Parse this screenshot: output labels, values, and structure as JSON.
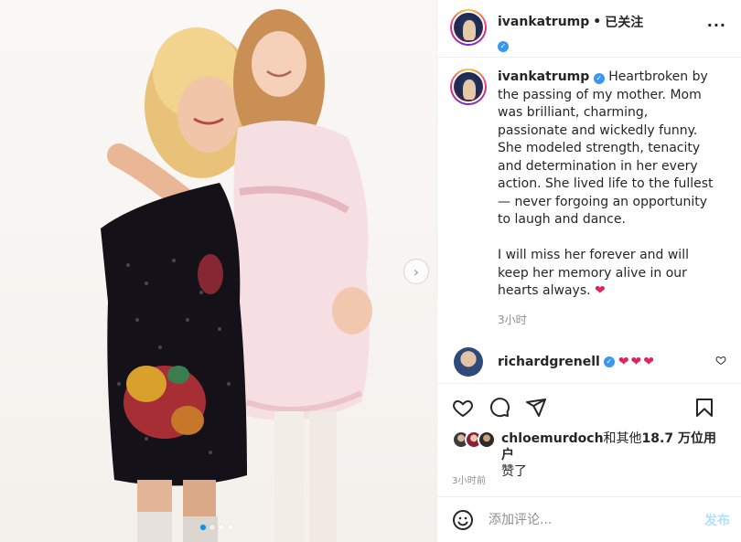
{
  "header": {
    "username": "ivankatrump",
    "separator": "•",
    "follow_status": "已关注",
    "more_label": "···"
  },
  "caption": {
    "username": "ivankatrump",
    "text": "Heartbroken by the passing of my mother. Mom was brilliant, charming, passionate and wickedly funny. She modeled strength, tenacity and determination in her every action. She lived life to the fullest — never forgoing an opportunity to laugh and dance.\n\nI will miss her forever and will keep her memory alive in our hearts always.",
    "emoji": "❤",
    "time": "3小时"
  },
  "comment": {
    "username": "richardgrenell",
    "text": "❤❤❤"
  },
  "likes": {
    "first_user": "chloemurdoch",
    "connector": "和其他",
    "count": "18.7 万位用户",
    "suffix": "赞了"
  },
  "timestamp": "3小时前",
  "add_comment": {
    "placeholder": "添加评论...",
    "post_label": "发布"
  },
  "carousel": {
    "slide_count": 4,
    "active_index": 0
  },
  "colors": {
    "verified": "#3897f0",
    "heart": "#e0245e",
    "carousel_active": "#0095f6",
    "post_disabled": "#b2dffc"
  }
}
